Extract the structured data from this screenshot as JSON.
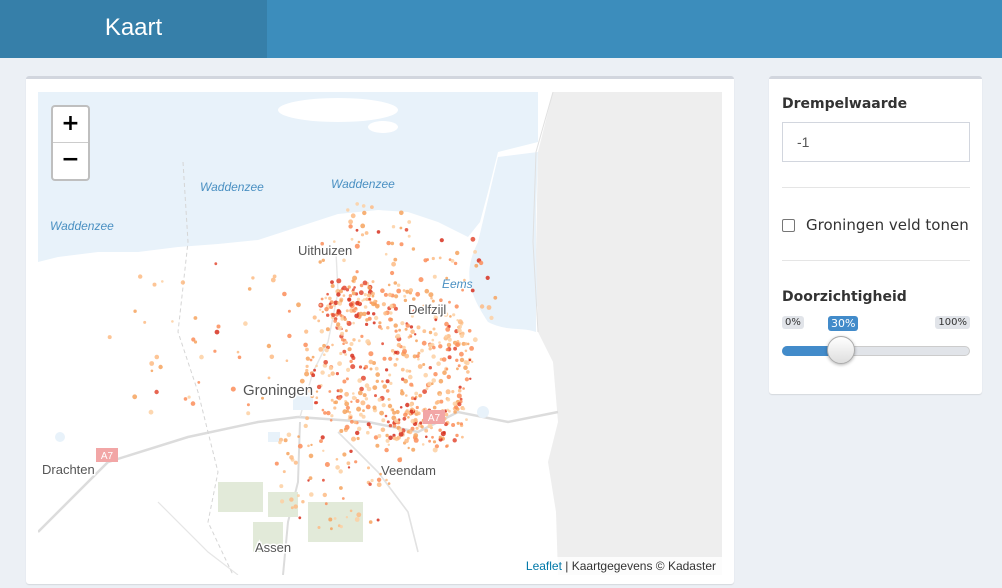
{
  "header": {
    "title": "Kaart"
  },
  "map": {
    "zoom_in": "+",
    "zoom_out": "−",
    "attribution_link": "Leaflet",
    "attribution_text": " | Kaartgegevens © Kadaster",
    "places": [
      "Uithuizen",
      "Delfzijl",
      "Groningen",
      "Veendam",
      "Drachten",
      "Assen"
    ],
    "water_labels": [
      "Waddenzee",
      "Waddenzee",
      "Waddenzee",
      "Eems"
    ],
    "road_labels": [
      "A7",
      "A7"
    ]
  },
  "controls": {
    "threshold_label": "Drempelwaarde",
    "threshold_value": "-1",
    "groningen_field_label": "Groningen veld tonen",
    "groningen_field_checked": false,
    "opacity_label": "Doorzichtigheid",
    "opacity_min": "0%",
    "opacity_max": "100%",
    "opacity_value": "30%",
    "opacity_fraction": 0.3
  },
  "colors": {
    "header": "#3c8dbc",
    "logo": "#367fa9",
    "accent": "#428bca"
  }
}
